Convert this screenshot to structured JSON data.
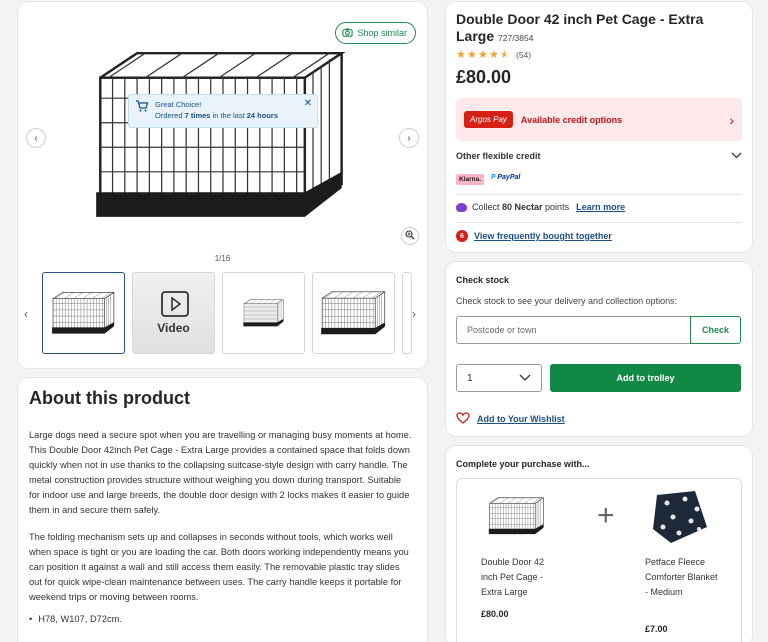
{
  "gallery": {
    "shop_similar": "Shop similar",
    "popup": {
      "title": "Great Choice!",
      "line_prefix": "Ordered ",
      "times": "7 times",
      "middle": " in the last ",
      "hours": "24 hours"
    },
    "counter": "1/16",
    "video_label": "Video"
  },
  "about": {
    "heading": "About this product",
    "para1": "Large dogs need a secure spot when you are travelling or managing busy moments at home. This Double Door 42inch Pet Cage - Extra Large provides a contained space that folds down quickly when not in use thanks to the collapsing suitcase-style design with carry handle. The metal construction provides structure without weighing you down during transport. Suitable for indoor use and large breeds, the double door design with 2 locks makes it easier to guide them in and secure them safely.",
    "para2": "The folding mechanism sets up and collapses in seconds without tools, which works well when space is tight or you are loading the car. Both doors working independently means you can position it against a wall and still access them easily. The removable plastic tray slides out for quick wipe-clean maintenance between uses. The carry handle keeps it portable for weekend trips or moving between rooms.",
    "bullet": "H78, W107, D72cm."
  },
  "product": {
    "title": "Double Door 42 inch Pet Cage - Extra Large",
    "sku": "727/3854",
    "rating": 4.5,
    "review_count": "(54)",
    "price": "£80.00",
    "argos_pay_logo": "Argos Pay",
    "argos_pay_text": "Available credit options",
    "other_credit": "Other flexible credit",
    "klarna": "Klarna.",
    "paypal": "PayPal",
    "nectar_prefix": "Collect ",
    "nectar_points": "80 Nectar",
    "nectar_suffix": " points",
    "learn_more": "Learn more",
    "fbt_count": "6",
    "fbt_link": "View frequently bought together"
  },
  "stock": {
    "heading": "Check stock",
    "subtitle": "Check stock to see your delivery and collection options:",
    "postcode_placeholder": "Postcode or town",
    "check_label": "Check",
    "qty_value": "1",
    "add_to_trolley": "Add to trolley",
    "wishlist": "Add to Your Wishlist"
  },
  "complete": {
    "heading": "Complete your purchase with...",
    "items": [
      {
        "name": "Double Door 42 inch Pet Cage - Extra Large",
        "price": "£80.00"
      },
      {
        "name": "Petface Fleece Comforter Blanket - Medium",
        "price": "£7.00"
      }
    ]
  },
  "colors": {
    "green": "#128846",
    "argos_red": "#d42114",
    "link_blue": "#1a4f86",
    "star": "#f4a12b"
  }
}
